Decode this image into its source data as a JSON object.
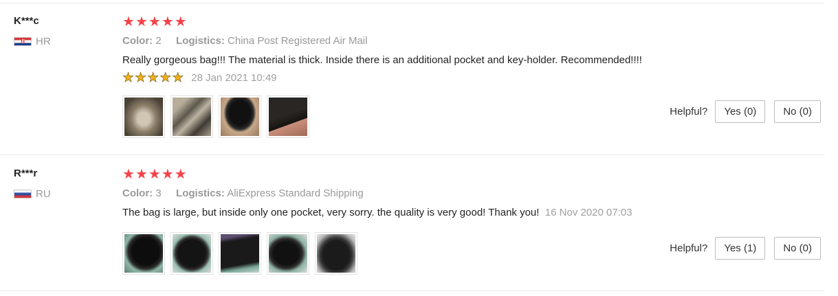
{
  "reviews": [
    {
      "user": "K***c",
      "country": "HR",
      "flag_icon": "croatia-flag-icon",
      "star_count": 5,
      "color_label": "Color:",
      "color_value": "2",
      "logistics_label": "Logistics:",
      "logistics_value": "China Post Registered Air Mail",
      "text": "Really gorgeous bag!!! The material is thick. Inside there is an additional pocket and key-holder. Recommended!!!!",
      "date": "28 Jan 2021 10:49",
      "photos": [
        "review-photo-1",
        "review-photo-2",
        "review-photo-3",
        "review-photo-4"
      ],
      "helpful_label": "Helpful?",
      "yes_label": "Yes (0)",
      "no_label": "No (0)"
    },
    {
      "user": "R***r",
      "country": "RU",
      "flag_icon": "russia-flag-icon",
      "star_count": 5,
      "color_label": "Color:",
      "color_value": "3",
      "logistics_label": "Logistics:",
      "logistics_value": "AliExpress Standard Shipping",
      "text": "The bag is large, but inside only one pocket, very sorry. the quality is very good! Thank you!",
      "date": "16 Nov 2020 07:03",
      "photos": [
        "review-photo-1",
        "review-photo-2",
        "review-photo-3",
        "review-photo-4",
        "review-photo-5"
      ],
      "helpful_label": "Helpful?",
      "yes_label": "Yes (1)",
      "no_label": "No (0)"
    }
  ],
  "colors": {
    "star_red": "#f5424a",
    "star_yellow": "#f2b21a",
    "muted_text": "#999999"
  }
}
